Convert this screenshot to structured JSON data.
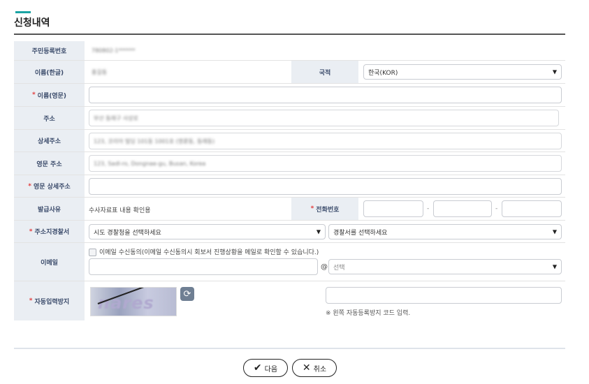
{
  "page": {
    "title": "신청내역"
  },
  "form": {
    "resident_number": {
      "label": "주민등록번호",
      "value": "780802-1******"
    },
    "name_korean": {
      "label": "이름(한글)",
      "value": "홍길동"
    },
    "nationality": {
      "label": "국적",
      "value": "한국(KOR)"
    },
    "name_english": {
      "label": "이름(영문)",
      "required": "*",
      "value": ""
    },
    "address": {
      "label": "주소",
      "value": "부산 동래구 사상로"
    },
    "address_detail": {
      "label": "상세주소",
      "value": "123, 코리아 빌딩 101동 1001호 (명륜동, 동래동)"
    },
    "address_english": {
      "label": "영문 주소",
      "value": "123, Sadl-ro, Dongnae-gu, Busan, Korea"
    },
    "address_english_detail": {
      "label": "영문 상세주소",
      "required": "*",
      "value": ""
    },
    "issue_reason": {
      "label": "발급사유",
      "value": "수사자료표 내용 확인용"
    },
    "phone": {
      "label": "전화번호",
      "required": "*",
      "sep": "-"
    },
    "police_station": {
      "label": "주소지경찰서",
      "required": "*",
      "province_placeholder": "시도 경찰청을 선택하세요",
      "station_placeholder": "경찰서를 선택하세요"
    },
    "email": {
      "label": "이메일",
      "consent_text": "이메일 수신동의(이메일 수신동의시 회보서 진행상황을 메일로 확인할 수 있습니다.)",
      "at": "@",
      "domain_placeholder": "선택"
    },
    "captcha": {
      "label": "자동입력방지",
      "required": "*",
      "image_text": "nares",
      "hint": "※ 왼쪽 자동등록방지 코드 입력."
    }
  },
  "buttons": {
    "next": "다음",
    "cancel": "취소"
  },
  "icons": {
    "select_caret": "▼",
    "refresh": "⟳",
    "check": "✔",
    "close": "✕"
  },
  "colors": {
    "accent": "#1aa3a3",
    "label_bg": "#eaeef3",
    "required": "#e23b3b"
  }
}
